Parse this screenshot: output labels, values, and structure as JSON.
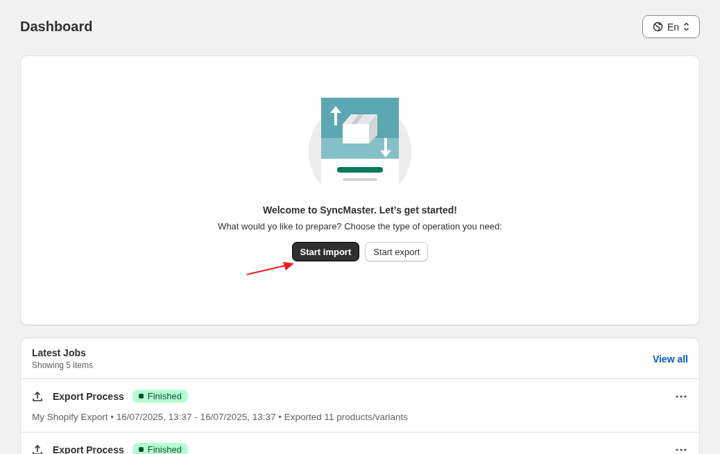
{
  "page": {
    "title": "Dashboard"
  },
  "language": {
    "label": "En"
  },
  "welcome": {
    "heading": "Welcome to SyncMaster. Let’s get started!",
    "text": "What would yo like to prepare? Choose the type of operation you need:",
    "buttons": [
      {
        "label": "Start import",
        "kind": "primary"
      },
      {
        "label": "Start export",
        "kind": "secondary"
      }
    ]
  },
  "jobs": {
    "title": "Latest Jobs",
    "subtitle": "Showing 5 items",
    "link": "View all",
    "items": [
      {
        "title": "Export Process",
        "status": "Finished",
        "color": "#b4fed2",
        "details": "My Shopify Export • 16/07/2025, 13:37 - 16/07/2025, 13:37 • Exported 11 products/variants"
      },
      {
        "title": "Export Process",
        "status": "Finished",
        "color": "#b4fed2"
      }
    ]
  }
}
